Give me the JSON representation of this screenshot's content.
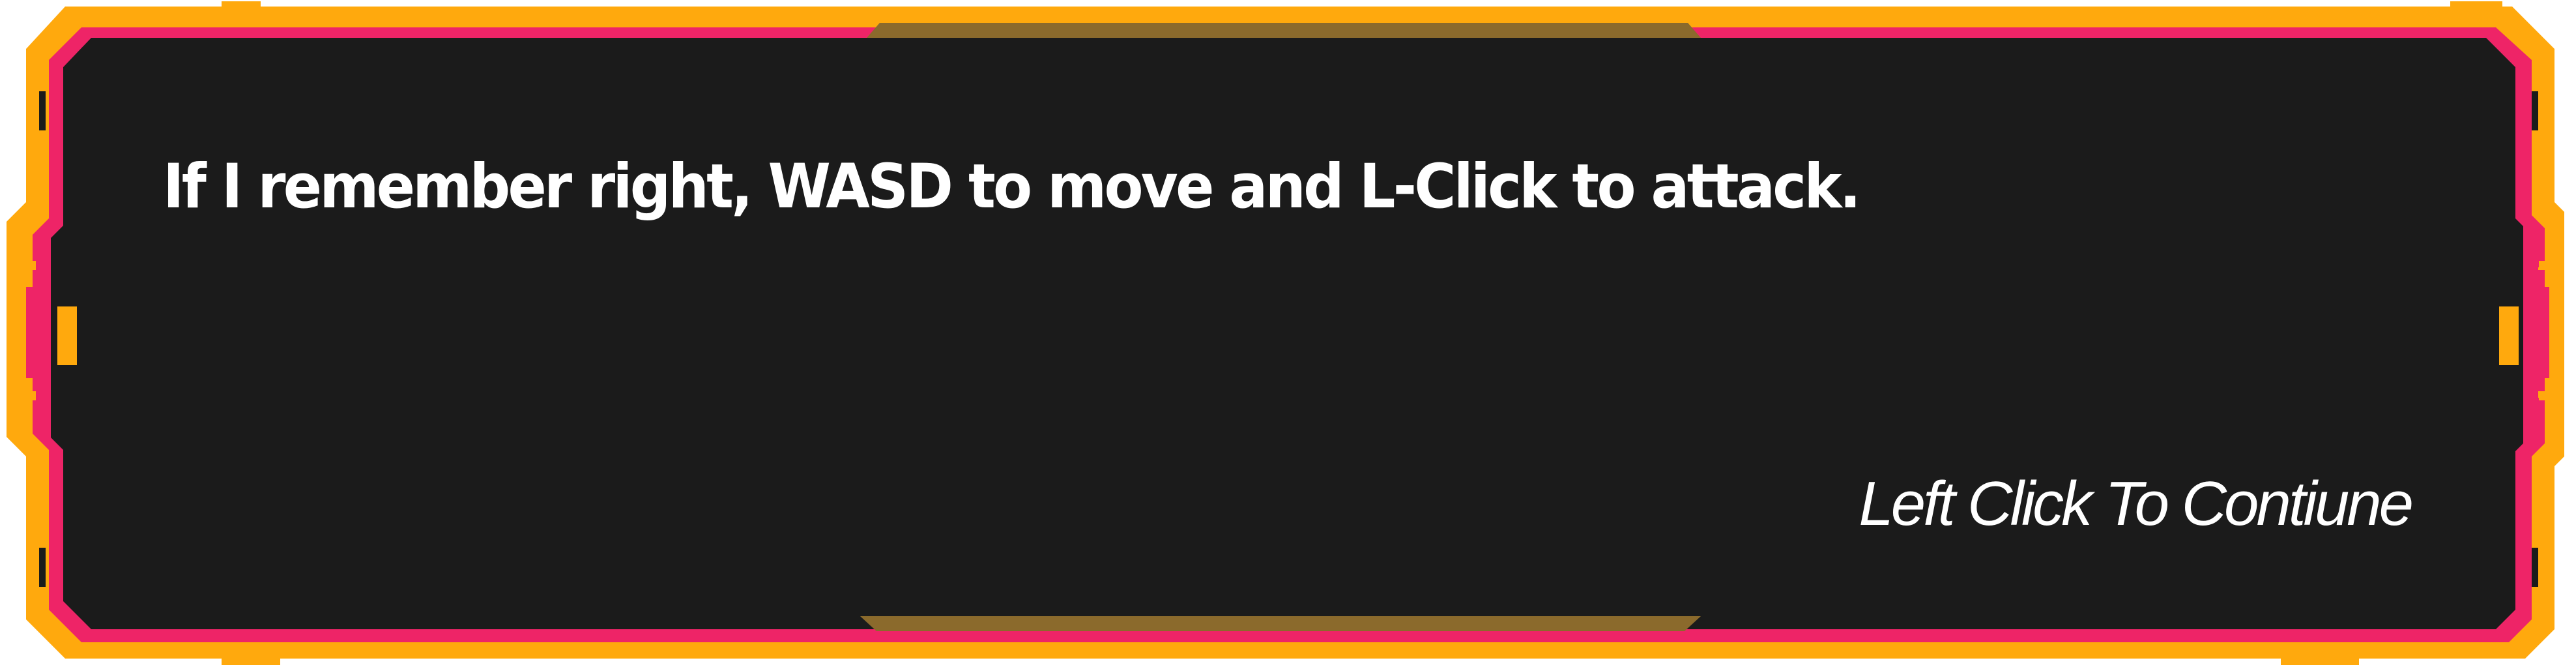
{
  "dialog": {
    "message": "If I remember right, WASD to move and L-Click to attack.",
    "continue_prompt": "Left Click To Contiune"
  },
  "colors": {
    "panel_fill": "#1b1b1b",
    "frame_orange": "#ffa90d",
    "frame_pink": "#ee2467",
    "accent_bronze": "#8b6a2c",
    "text": "#ffffff"
  }
}
